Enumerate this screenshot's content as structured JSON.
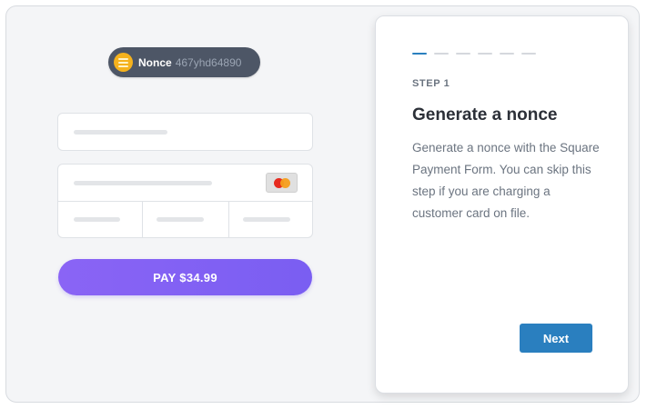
{
  "nonce": {
    "label": "Nonce",
    "value": "467yhd64890",
    "icon": "coin-icon"
  },
  "payment_form": {
    "pay_button_label": "PAY $34.99",
    "card_brand_icon": "mastercard-icon"
  },
  "step_panel": {
    "progress": {
      "total_steps": 6,
      "current_step": 1
    },
    "step_label": "STEP 1",
    "title": "Generate a nonce",
    "description": "Generate a nonce with the Square Payment Form. You can skip this step if you are charging a customer card on file.",
    "next_button_label": "Next"
  },
  "colors": {
    "pay_button": "#8a64f5",
    "accent_blue": "#2a7fbf",
    "nonce_pill": "#4d5666",
    "coin": "#f5b21d"
  }
}
